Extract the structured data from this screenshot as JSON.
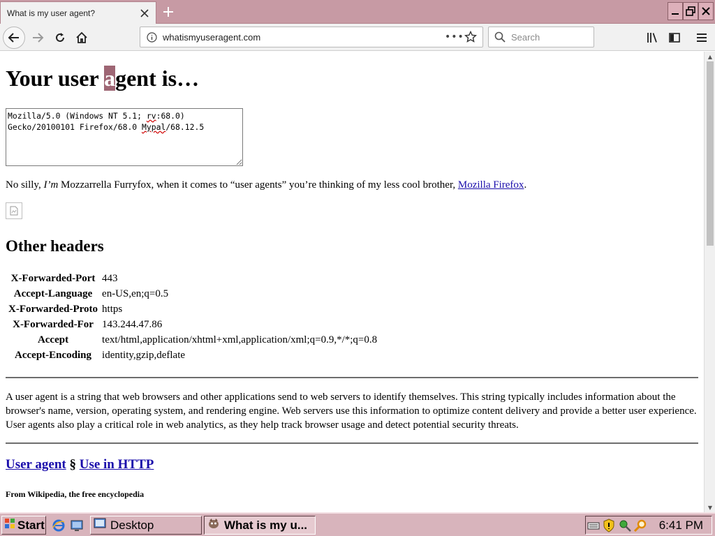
{
  "browser": {
    "tab_title": "What is my user agent?",
    "url": "whatismyuseragent.com",
    "search_placeholder": "Search",
    "icons": [
      "close-icon",
      "plus-icon",
      "back-icon",
      "forward-icon",
      "reload-icon",
      "home-icon",
      "info-icon",
      "more-icon",
      "star-icon",
      "search-icon",
      "library-icon",
      "sidebar-icon",
      "menu-icon",
      "minimize-icon",
      "restore-icon",
      "window-close-icon"
    ]
  },
  "page": {
    "heading_pre": "Your user ",
    "heading_highlight": "a",
    "heading_post": "gent is…",
    "ua_line1_a": "Mozilla/5.0 (Windows NT 5.1; ",
    "ua_line1_rv": "rv",
    "ua_line1_b": ":68.0)",
    "ua_line2_a": "Gecko/20100101 Firefox/68.0 ",
    "ua_line2_mypal": "Mypal",
    "ua_line2_b": "/68.12.5",
    "silly_pre": "No silly, ",
    "silly_em": "I’m",
    "silly_mid": " Mozzarrella Furryfox, when it comes to “user agents” you’re thinking of my less cool brother, ",
    "silly_link": "Mozilla Firefox",
    "silly_post": ".",
    "other_headers_title": "Other headers",
    "headers": [
      {
        "name": "X-Forwarded-Port",
        "value": "443"
      },
      {
        "name": "Accept-Language",
        "value": "en-US,en;q=0.5"
      },
      {
        "name": "X-Forwarded-Proto",
        "value": "https"
      },
      {
        "name": "X-Forwarded-For",
        "value": "143.244.47.86"
      },
      {
        "name": "Accept",
        "value": "text/html,application/xhtml+xml,application/xml;q=0.9,*/*;q=0.8"
      },
      {
        "name": "Accept-Encoding",
        "value": "identity,gzip,deflate"
      }
    ],
    "description": "A user agent is a string that web browsers and other applications send to web servers to identify themselves. This string typically includes information about the browser's name, version, operating system, and rendering engine. Web servers use this information to optimize content delivery and provide a better user experience. User agents also play a critical role in web analytics, as they help track browser usage and detect potential security threats.",
    "link_user_agent": "User agent",
    "section_sign": " § ",
    "link_use_http": "Use in HTTP",
    "from_wikipedia": "From Wikipedia, the free encyclopedia"
  },
  "taskbar": {
    "start_label": "Start",
    "desktop_label": "Desktop",
    "active_window_label": "What is my u...",
    "clock": "6:41 PM"
  },
  "colors": {
    "tabbar": "#c79aa4",
    "taskbar": "#d8b4bc",
    "highlight": "#9e6674",
    "link": "#1a0dab"
  }
}
